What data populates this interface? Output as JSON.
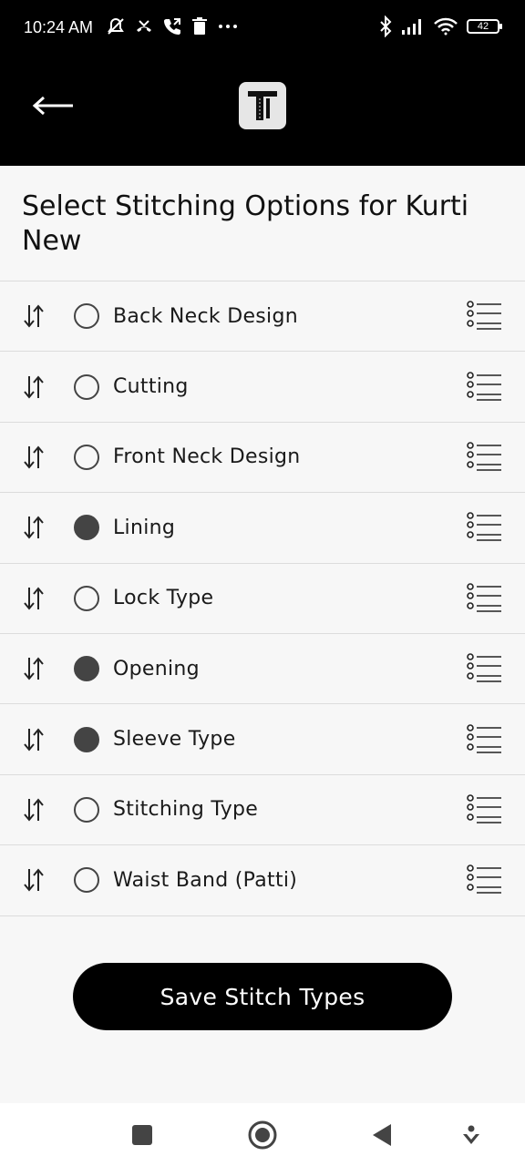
{
  "status_bar": {
    "time": "10:24 AM",
    "battery": "42",
    "icons_left": [
      "mute-icon",
      "missed-call-icon",
      "call-forward-icon",
      "trash-icon",
      "more-dots-icon"
    ],
    "icons_right": [
      "bluetooth-icon",
      "signal-icon",
      "wifi-icon",
      "battery-icon"
    ]
  },
  "app_bar": {
    "back_icon": "arrow-left-icon",
    "logo_icon": "tailor-logo-icon"
  },
  "page": {
    "title": "Select Stitching Options for Kurti New"
  },
  "options": [
    {
      "label": "Back Neck Design",
      "selected": false
    },
    {
      "label": "Cutting",
      "selected": false
    },
    {
      "label": "Front Neck Design",
      "selected": false
    },
    {
      "label": "Lining",
      "selected": true
    },
    {
      "label": "Lock Type",
      "selected": false
    },
    {
      "label": "Opening",
      "selected": true
    },
    {
      "label": "Sleeve Type",
      "selected": true
    },
    {
      "label": "Stitching Type",
      "selected": false
    },
    {
      "label": "Waist Band (Patti)",
      "selected": false
    }
  ],
  "actions": {
    "save_label": "Save Stitch Types"
  },
  "nav_bar": {
    "items": [
      "recents-icon",
      "home-icon",
      "back-icon",
      "assistant-icon"
    ]
  },
  "colors": {
    "header_bg": "#000000",
    "page_bg": "#f7f7f7",
    "selected_radio": "#444444",
    "button_bg": "#000000"
  }
}
